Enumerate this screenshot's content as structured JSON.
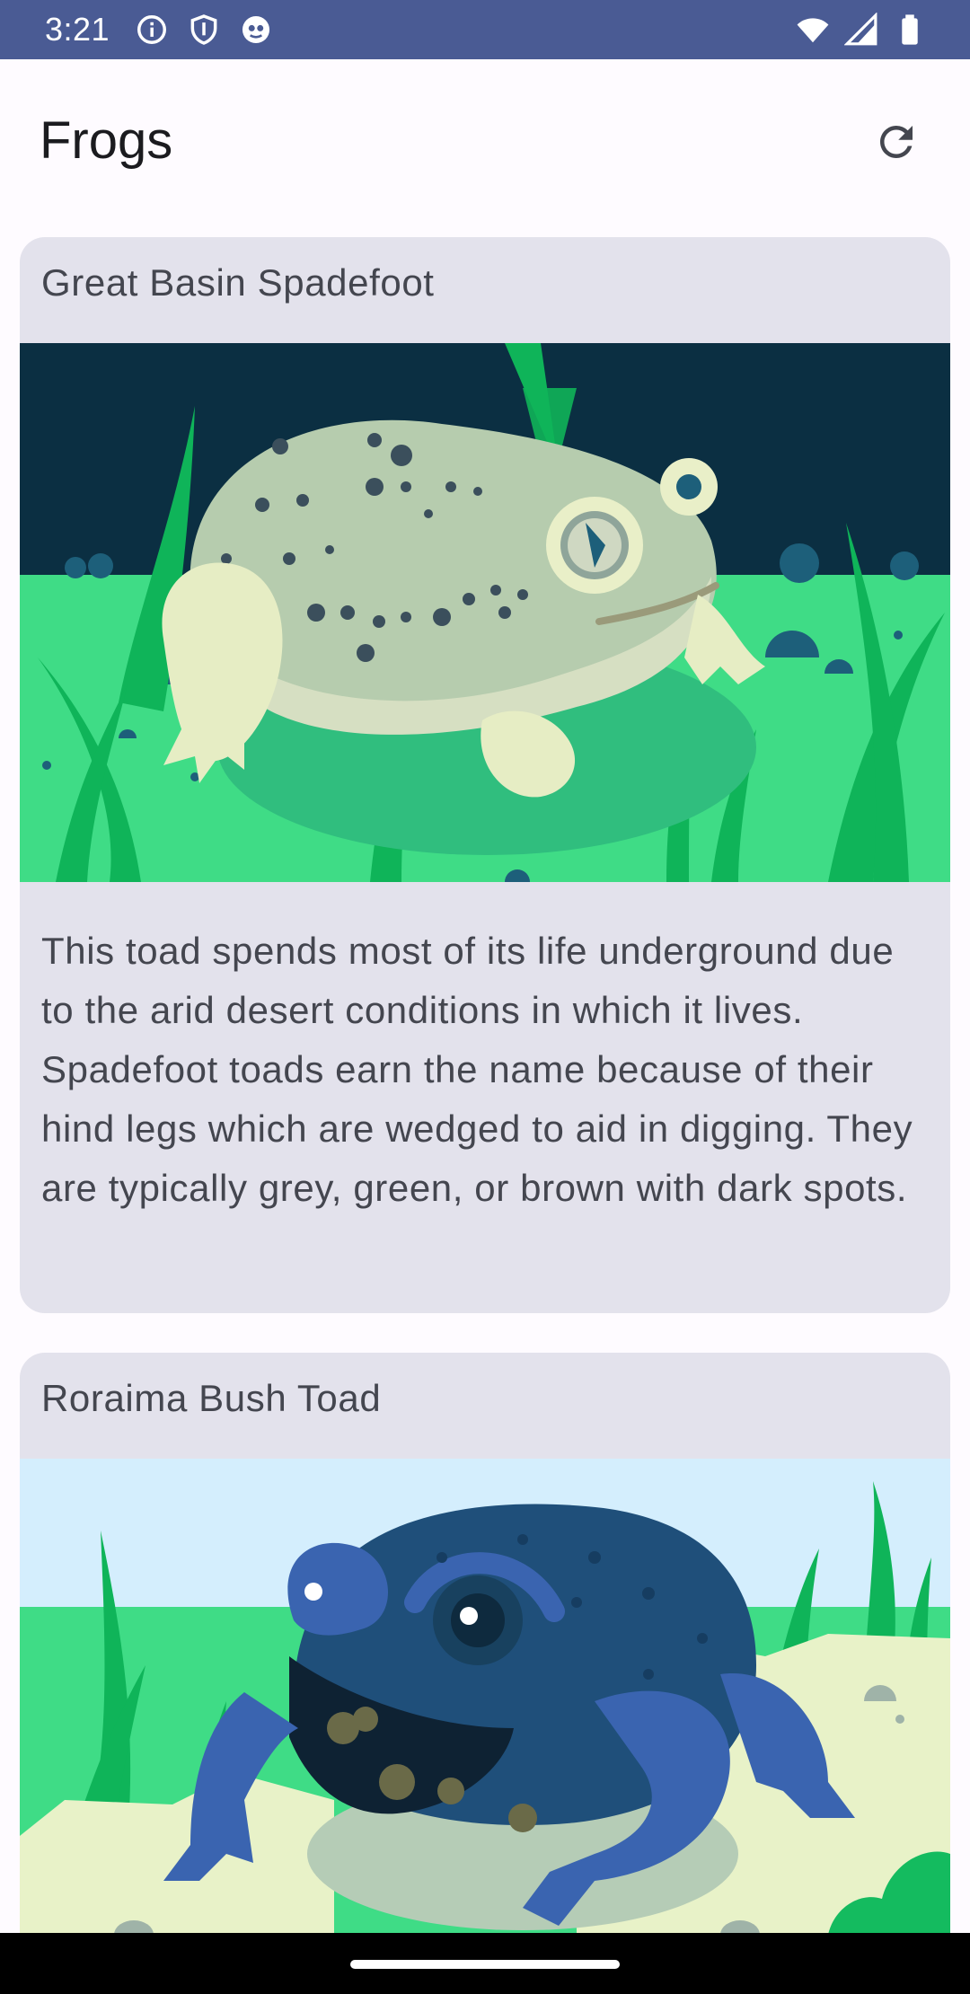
{
  "status_bar": {
    "time": "3:21",
    "left_icons": [
      "info-icon",
      "shield-icon",
      "app-notification-icon"
    ],
    "right_icons": [
      "wifi-icon",
      "cellular-icon",
      "battery-icon"
    ],
    "background": "#4a5b94"
  },
  "app_bar": {
    "title": "Frogs",
    "refresh_icon": "refresh-icon"
  },
  "frogs": [
    {
      "name": "Great Basin Spadefoot",
      "description": "This toad spends most of its life underground due to the arid desert conditions in which it lives. Spadefoot toads earn the name because of their hind legs which are wedged to aid in digging. They are typically grey, green, or brown with dark spots."
    },
    {
      "name": "Roraima Bush Toad"
    }
  ],
  "colors": {
    "card_background": "#e3e2ec",
    "page_background": "#fefbff",
    "text": "#44464f"
  }
}
